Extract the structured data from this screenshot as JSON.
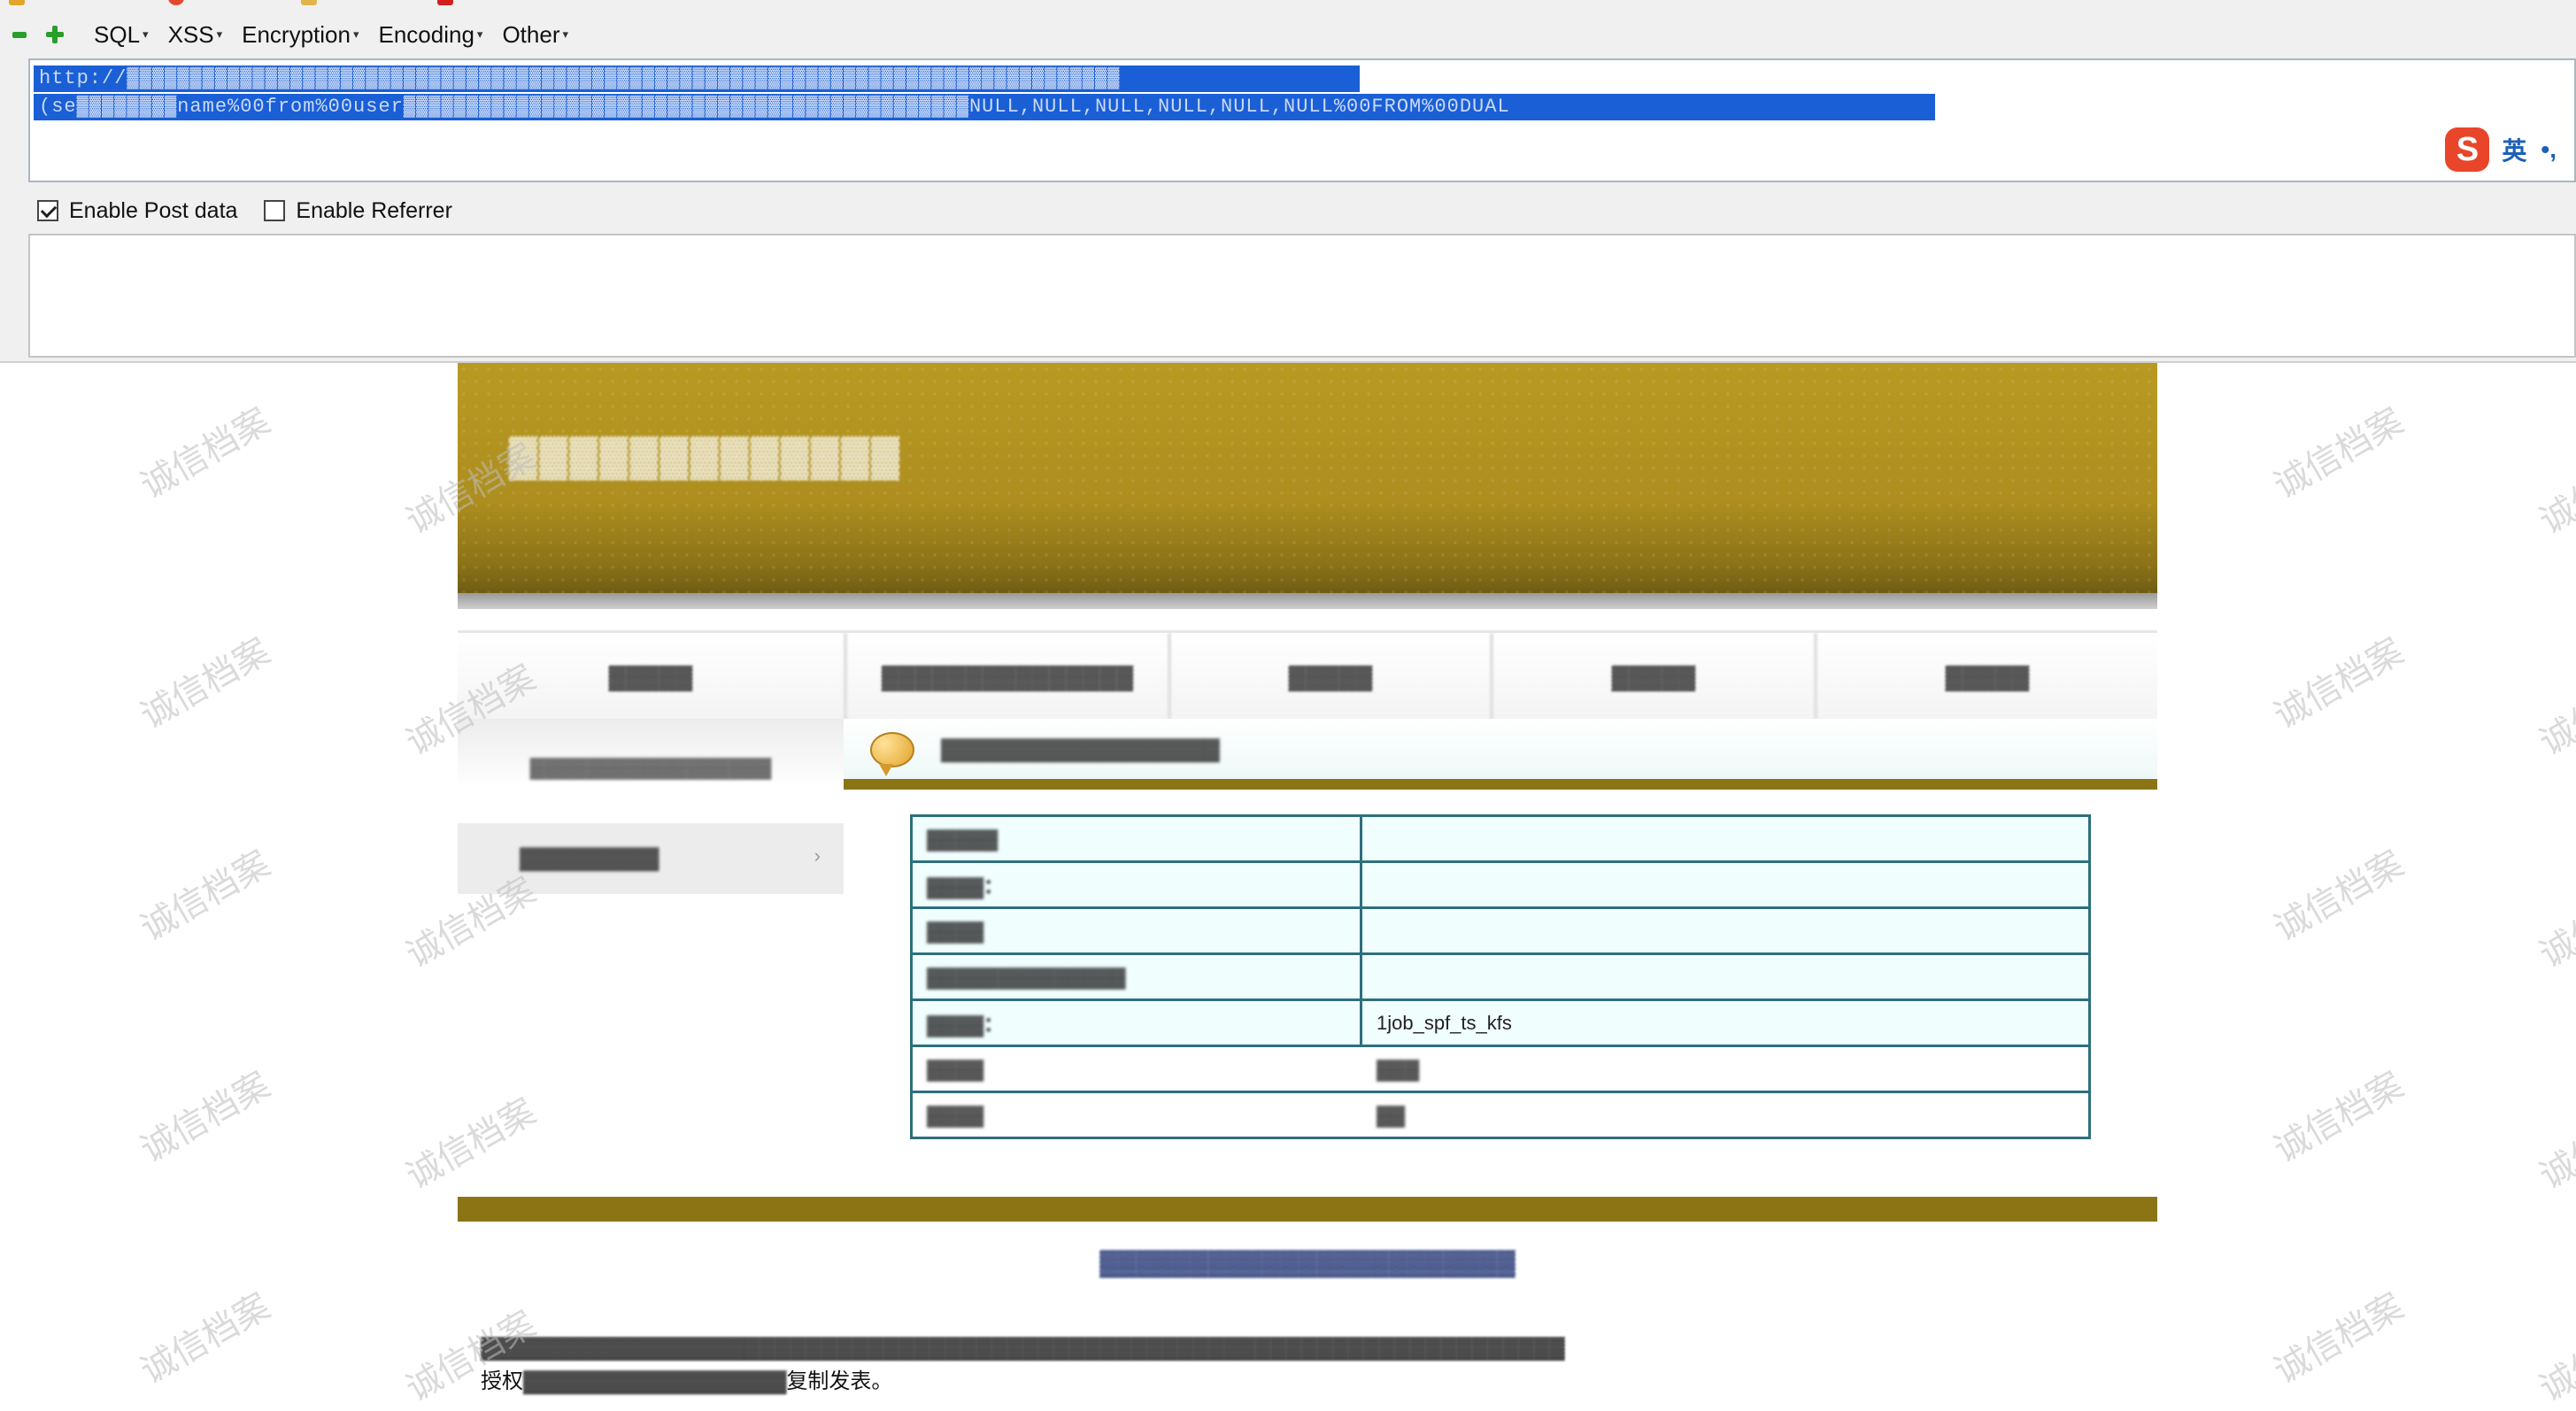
{
  "hackbar": {
    "menu": [
      "SQL",
      "XSS",
      "Encryption",
      "Encoding",
      "Other"
    ],
    "url_line1": "http://▓▓▓▓▓▓▓▓▓▓▓▓▓▓▓▓▓▓▓▓▓▓▓▓▓▓▓▓▓▓▓▓▓▓▓▓▓▓▓▓▓▓▓▓▓▓▓▓▓▓▓▓▓▓▓▓▓▓▓▓▓▓▓▓▓▓▓▓▓▓▓▓▓▓▓▓▓▓▓",
    "url_line2": "(se▓▓▓▓▓▓▓▓name%00from%00user▓▓▓▓▓▓▓▓▓▓▓▓▓▓▓▓▓▓▓▓▓▓▓▓▓▓▓▓▓▓▓▓▓▓▓▓▓▓▓▓▓▓▓▓▓NULL,NULL,NULL,NULL,NULL,NULL%00FROM%00DUAL",
    "ime": {
      "logo": "S",
      "lang": "英",
      "punct": "•,"
    },
    "options": [
      {
        "label": "Enable Post data",
        "checked": true
      },
      {
        "label": "Enable Referrer",
        "checked": false
      }
    ]
  },
  "site": {
    "banner_title": "▓▓▓▓▓▓▓▓▓▓▓▓▓",
    "nav": [
      "▓▓▓▓▓",
      "▓▓▓▓▓▓▓▓▓▓▓▓▓▓▓",
      "▓▓▓▓▓",
      "▓▓▓▓▓",
      "▓▓▓▓▓"
    ],
    "side_top": "▓▓▓▓▓▓▓▓▓▓▓▓▓▓▓▓▓",
    "side_active": "▓▓▓▓▓▓▓▓▓",
    "side_arrow": "›",
    "content_heading": "▓▓▓▓▓▓▓▓▓▓▓▓▓▓▓▓▓▓",
    "table": [
      {
        "label": "▓▓▓▓▓",
        "value": ""
      },
      {
        "label": "▓▓▓▓：",
        "value": ""
      },
      {
        "label": "▓▓▓▓",
        "value": ""
      },
      {
        "label": "▓▓▓▓▓▓▓▓▓▓▓▓▓▓",
        "value": ""
      },
      {
        "label": "▓▓▓▓：",
        "value": "1job_spf_ts_kfs"
      },
      {
        "label": "▓▓▓▓",
        "value": "▓▓▓"
      },
      {
        "label": "▓▓▓▓",
        "value": "▓▓"
      }
    ],
    "footer_title": "▓▓▓▓▓▓▓▓▓▓▓▓▓▓▓▓▓▓▓▓▓▓▓",
    "footer_line1": "▓▓▓▓▓▓▓▓▓▓▓▓▓▓▓▓▓▓▓▓▓▓▓▓▓▓▓▓▓▓▓▓▓▓▓▓▓▓▓▓▓▓▓▓▓▓▓▓▓▓▓▓▓▓▓▓▓▓▓▓▓▓▓▓▓▓▓▓▓▓",
    "footer_line2_prefix": "授权",
    "footer_line2_mid": "▓▓▓▓▓▓▓▓▓▓▓▓▓▓▓▓▓",
    "footer_line2_suffix": "复制发表。"
  },
  "watermark": "诚信档案"
}
